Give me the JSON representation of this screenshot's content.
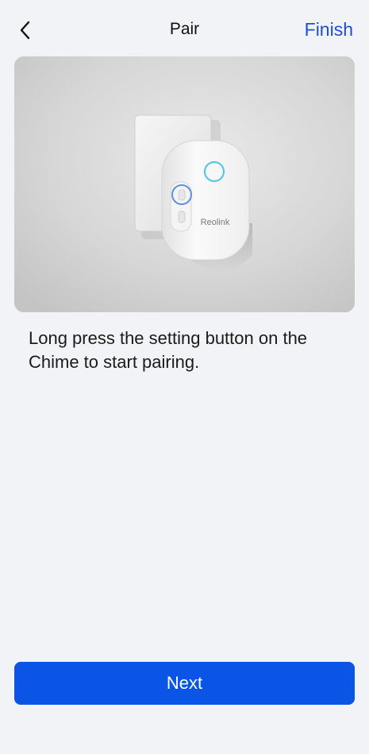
{
  "nav": {
    "back_icon": "chevron-left-icon",
    "title": "Pair",
    "finish_label": "Finish"
  },
  "hero": {
    "device_brand": "Reolink"
  },
  "instruction": "Long press the setting button on the Chime to start pairing.",
  "footer": {
    "next_label": "Next"
  },
  "colors": {
    "background": "#f2f3f6",
    "accent": "#0a55e6",
    "link": "#1a4fd6"
  }
}
